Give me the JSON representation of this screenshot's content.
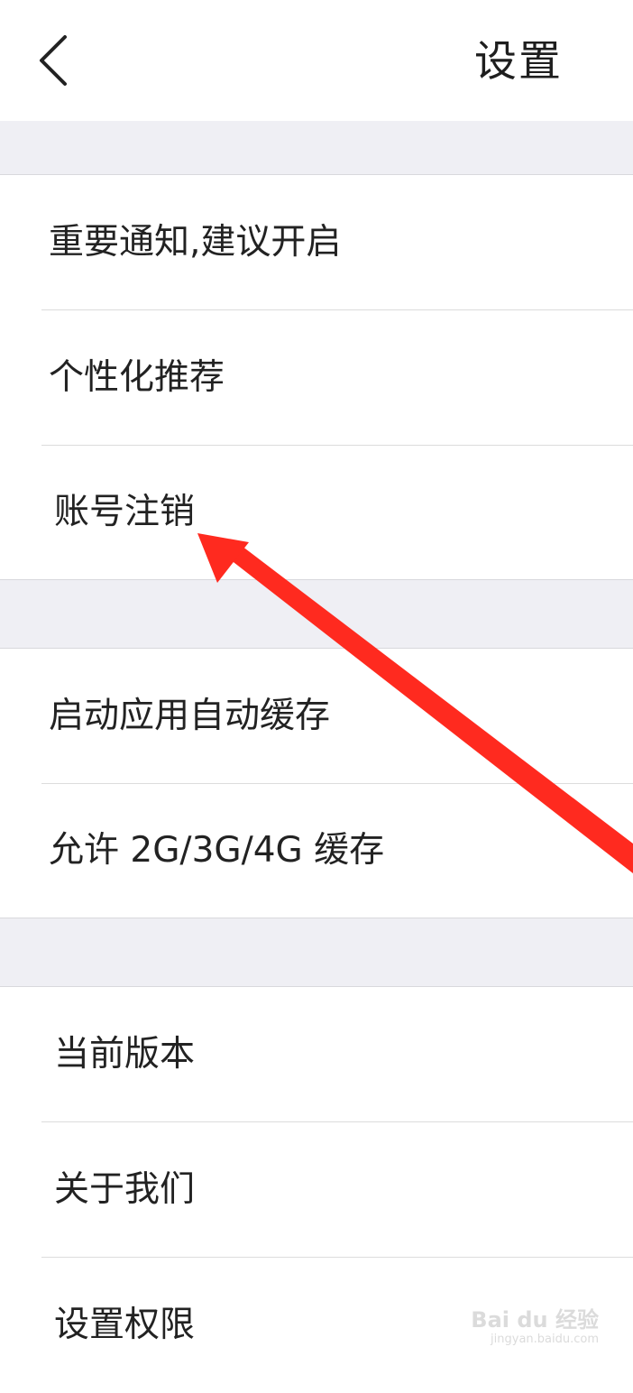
{
  "header": {
    "title": "设置",
    "back_icon": "chevron-left-icon"
  },
  "sections": [
    {
      "items": [
        {
          "label": "重要通知,建议开启"
        },
        {
          "label": "个性化推荐"
        },
        {
          "label": "账号注销"
        }
      ]
    },
    {
      "items": [
        {
          "label": "启动应用自动缓存"
        },
        {
          "label": "允许 2G/3G/4G 缓存"
        }
      ]
    },
    {
      "items": [
        {
          "label": "当前版本"
        },
        {
          "label": "关于我们"
        },
        {
          "label": "设置权限"
        }
      ]
    }
  ],
  "annotation": {
    "arrow_color": "#ff2a1f",
    "points_to": "账号注销"
  },
  "watermark": {
    "main": "Bai du 经验",
    "url": "jingyan.baidu.com"
  },
  "colors": {
    "separator_bg": "#efeff4",
    "row_bg": "#ffffff",
    "text": "#222222"
  }
}
